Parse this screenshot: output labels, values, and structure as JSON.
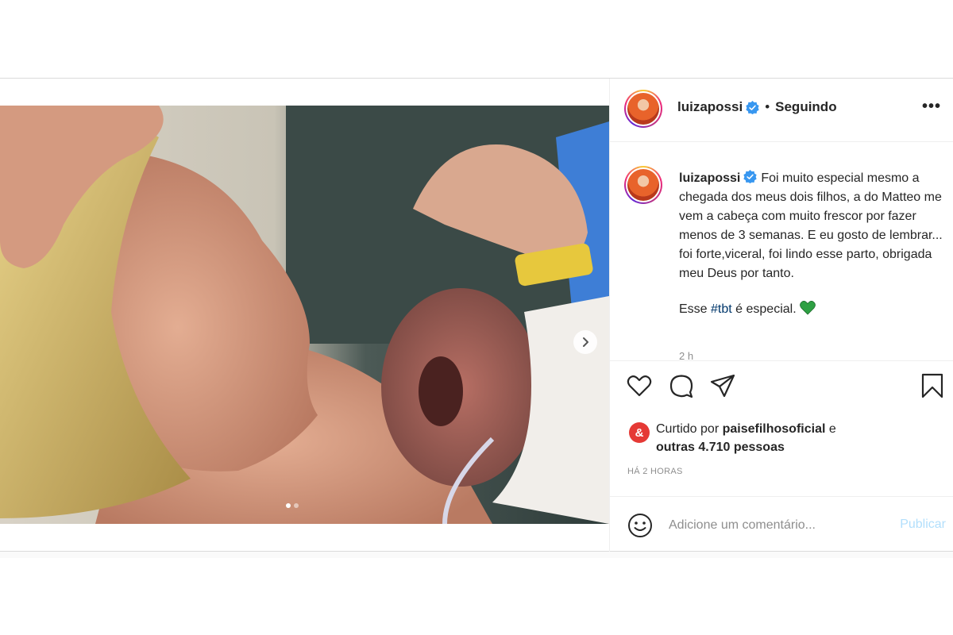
{
  "header": {
    "username": "luizapossi",
    "verified_icon": "verified-badge-icon",
    "separator": "•",
    "following_label": "Seguindo",
    "more_label": "•••"
  },
  "caption": {
    "username": "luizapossi",
    "text": "Foi muito especial mesmo a chegada dos meus dois filhos, a do Matteo me vem a cabeça com muito frescor por fazer menos de 3 semanas. E eu gosto de lembrar... foi forte,viceral, foi lindo esse parto, obrigada meu Deus por tanto.",
    "second_line_before": "Esse ",
    "hashtag": "#tbt",
    "second_line_after": " é especial.",
    "emoji": "green-heart",
    "time": "2 h"
  },
  "media": {
    "current_slide": 1,
    "total_slides": 2
  },
  "actions": {
    "like_icon": "heart-outline-icon",
    "comment_icon": "comment-bubble-icon",
    "share_icon": "paper-plane-icon",
    "save_icon": "bookmark-icon"
  },
  "likes": {
    "liker_avatar_letter": "&",
    "prefix": "Curtido por ",
    "liker": "paisefilhosoficial",
    "middle": " e",
    "others": "outras 4.710 pessoas"
  },
  "timestamp": "HÁ 2 HORAS",
  "comment": {
    "placeholder": "Adicione um comentário...",
    "publish_label": "Publicar"
  },
  "colors": {
    "link": "#00376b",
    "publish_disabled": "#b2dffc",
    "verified": "#3897f0",
    "heart_green": "#2ea043"
  }
}
